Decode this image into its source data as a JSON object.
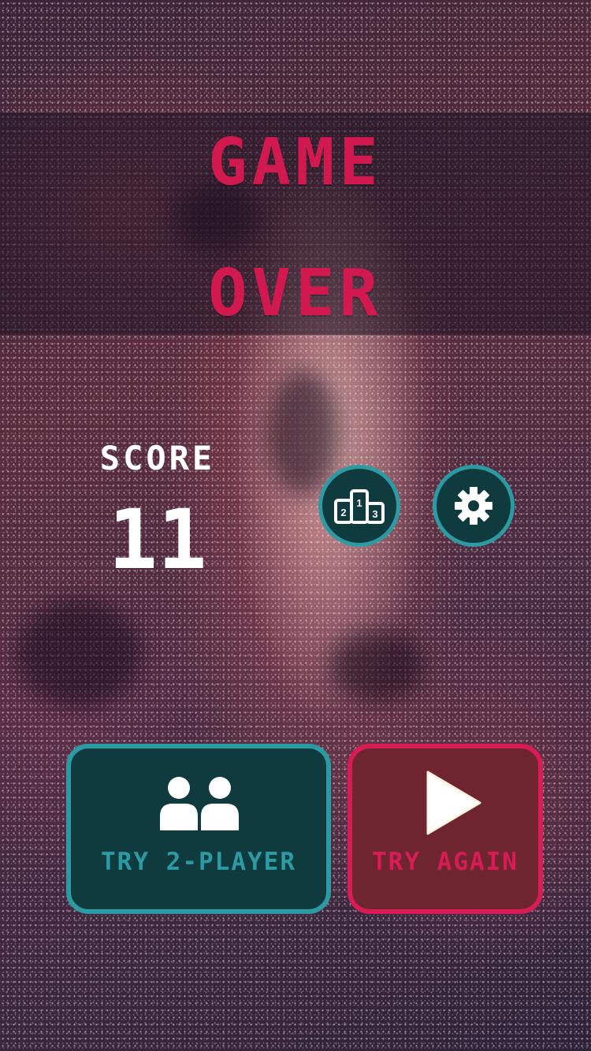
{
  "title": {
    "line1": "GAME",
    "line2": "OVER"
  },
  "score": {
    "label": "SCORE",
    "value": "11"
  },
  "actions": {
    "leaderboard_icon": "podium-icon",
    "settings_icon": "gear-icon",
    "two_player_label": "TRY 2-PLAYER",
    "two_player_icon": "two-players-icon",
    "try_again_label": "TRY AGAIN",
    "try_again_icon": "play-icon"
  },
  "colors": {
    "title": "#d2194f",
    "teal_fill": "#0f3a3e",
    "teal_border": "#2c9aa3",
    "red_fill": "#6e2530",
    "red_border": "#d81b55"
  }
}
